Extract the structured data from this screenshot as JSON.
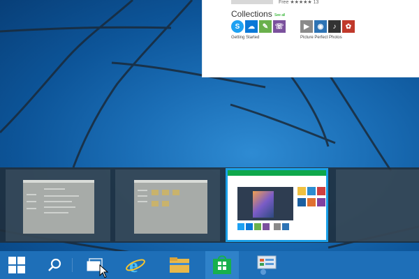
{
  "store_window": {
    "price": "Free",
    "stars": "★★★★★",
    "rating_count": "13",
    "collections_title": "Collections",
    "see_all": "See all",
    "collection_1_caption": "Getting Started",
    "collection_2_caption": "Picture Perfect Photos",
    "collection_1_apps": [
      "skype-icon",
      "onedrive-icon",
      "maps-icon",
      "viber-icon"
    ],
    "collection_2_apps": [
      "photo-app-icon",
      "camera-icon",
      "music-icon",
      "painting-icon"
    ]
  },
  "taskbar": {
    "buttons": [
      "start-button",
      "search-button",
      "task-view-button",
      "internet-explorer-button",
      "file-explorer-button",
      "store-button",
      "control-panel-button"
    ]
  },
  "colors": {
    "taskbar": "#1e6fb8",
    "store_accent": "#0fa84b",
    "selected_border": "#1aa0e8"
  }
}
